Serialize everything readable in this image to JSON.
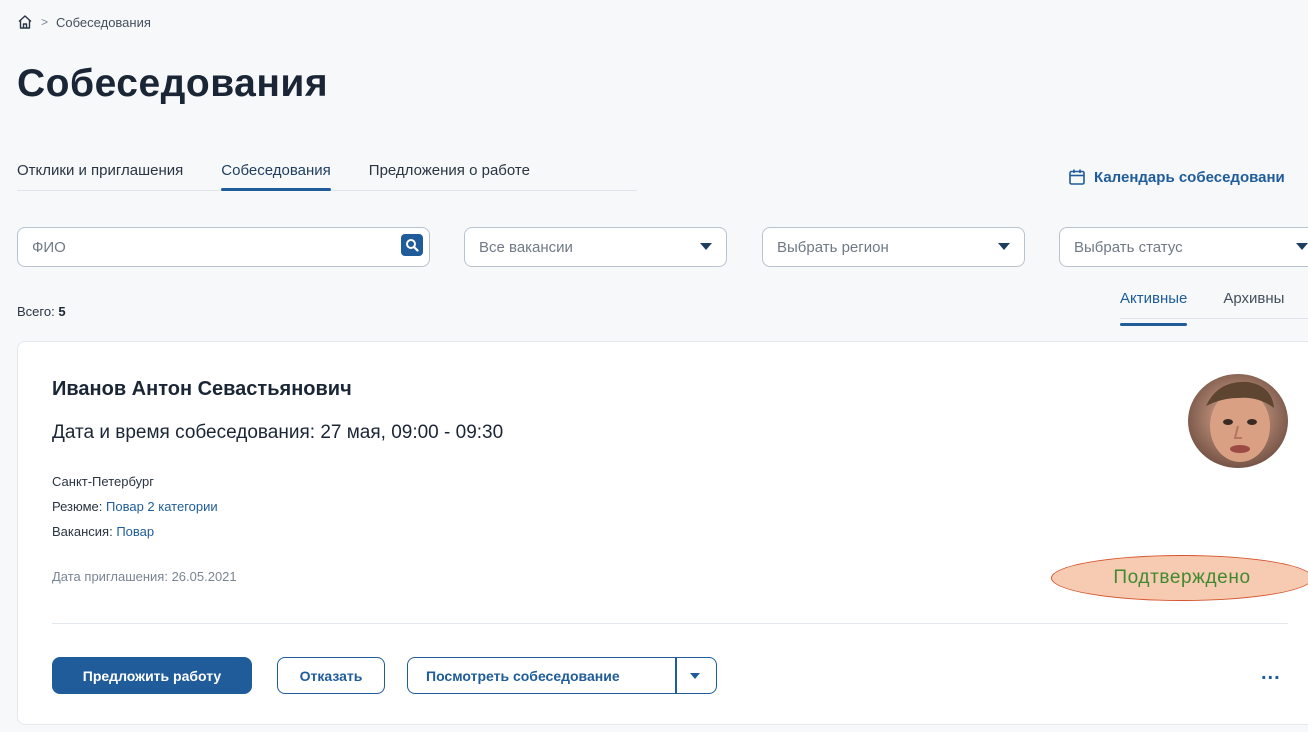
{
  "breadcrumb": {
    "home_icon": "home-icon",
    "separator": ">",
    "current": "Собеседования"
  },
  "page_title": "Собеседования",
  "tabs": [
    {
      "label": "Отклики и приглашения",
      "active": false
    },
    {
      "label": "Собеседования",
      "active": true
    },
    {
      "label": "Предложения о работе",
      "active": false
    }
  ],
  "calendar_link": {
    "icon": "calendar-icon",
    "label": "Календарь собеседовани"
  },
  "filters": {
    "fio_placeholder": "ФИО",
    "vacancy": "Все вакансии",
    "region": "Выбрать регион",
    "status": "Выбрать статус"
  },
  "total": {
    "label": "Всего:",
    "count": "5"
  },
  "status_tabs": [
    {
      "label": "Активные",
      "active": true
    },
    {
      "label": "Архивны",
      "active": false
    }
  ],
  "card": {
    "name": "Иванов Антон Севастьянович",
    "interview_date": "Дата и время собеседования: 27 мая, 09:00 - 09:30",
    "city": "Санкт-Петербург",
    "resume_label": "Резюме:",
    "resume_link": "Повар 2 категории",
    "vacancy_label": "Вакансия:",
    "vacancy_link": "Повар",
    "invite_date": "Дата приглашения: 26.05.2021",
    "status": "Подтверждено",
    "buttons": {
      "offer": "Предложить работу",
      "reject": "Отказать",
      "view": "Посмотреть собеседование",
      "more": "..."
    }
  },
  "colors": {
    "accent": "#1f5c99",
    "status_text": "#3f8a2f",
    "status_bg": "#f7cbb2",
    "status_border": "#d4542c"
  }
}
